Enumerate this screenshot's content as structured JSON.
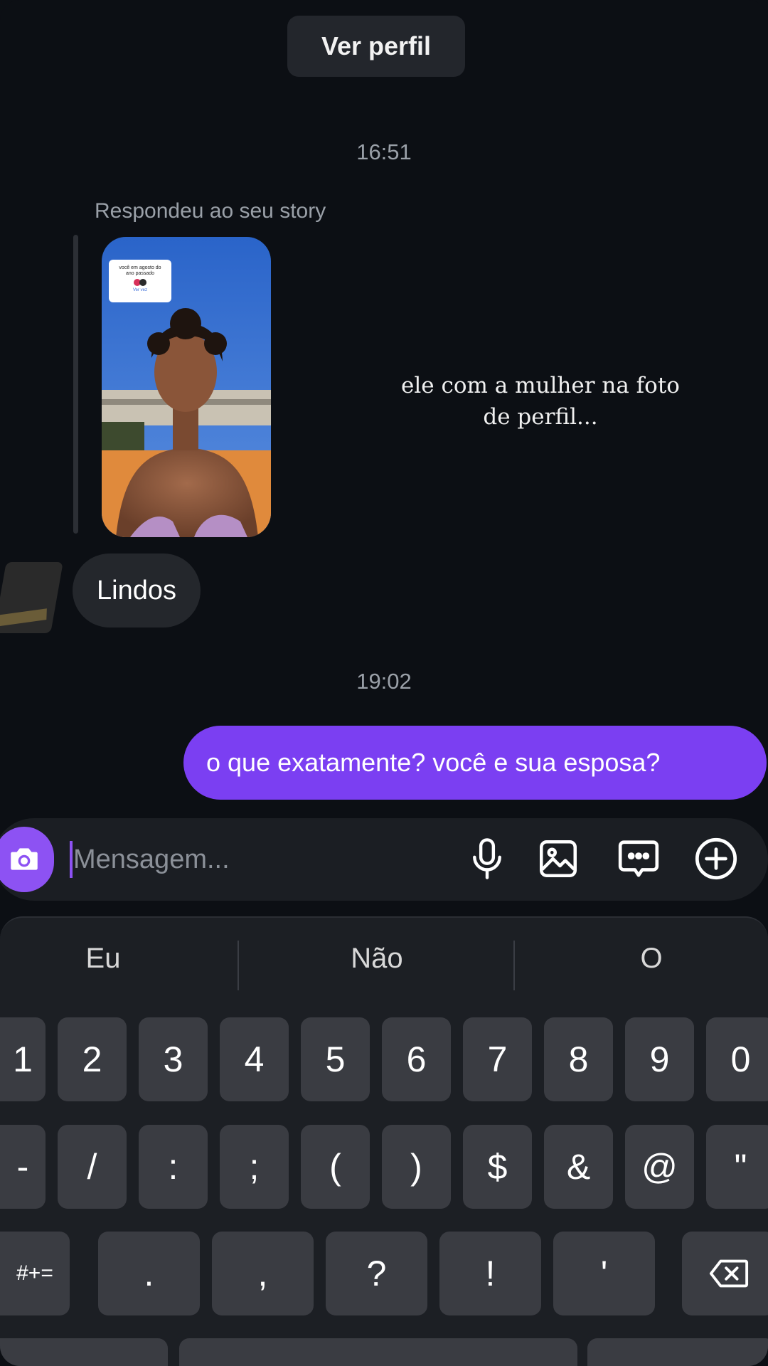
{
  "header": {
    "view_profile": "Ver perfil"
  },
  "chat": {
    "time_1": "16:51",
    "reply_label": "Respondeu ao seu story",
    "story_card": {
      "line1": "você em agosto do",
      "line2": "ano passado",
      "see_all": "Ver vez"
    },
    "caption": "ele com a mulher na foto de perfil...",
    "incoming_message": "Lindos",
    "time_2": "19:02",
    "outgoing_message": "o que exatamente? você e sua esposa?"
  },
  "composer": {
    "placeholder": "Mensagem...",
    "icons": [
      "camera-icon",
      "microphone-icon",
      "gallery-icon",
      "sticker-chat-icon",
      "plus-circle-icon"
    ],
    "accent": "#8d52f3"
  },
  "keyboard": {
    "suggestions": [
      "Eu",
      "Não",
      "O"
    ],
    "row1": [
      "1",
      "2",
      "3",
      "4",
      "5",
      "6",
      "7",
      "8",
      "9",
      "0"
    ],
    "row2": [
      "-",
      "/",
      ":",
      ";",
      "(",
      ")",
      "$",
      "&",
      "@",
      "\""
    ],
    "row3": [
      "#+=",
      ".",
      ",",
      "?",
      "!",
      "'"
    ]
  },
  "colors": {
    "background": "#0c0f14",
    "outgoing_bubble": "#7b3ff2",
    "incoming_bubble": "#24272c",
    "key": "#3a3c42"
  }
}
